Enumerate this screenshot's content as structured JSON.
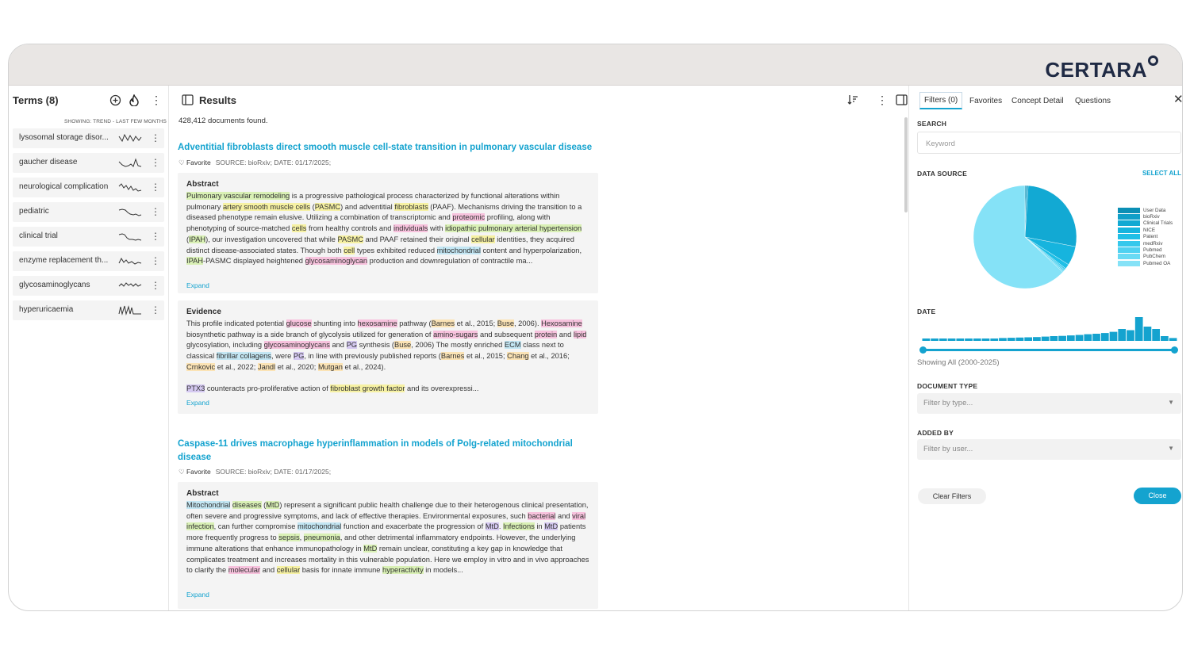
{
  "brand": {
    "name": "CERTARA"
  },
  "terms": {
    "title": "Terms (8)",
    "showing": "SHOWING: TREND - LAST FEW MONTHS",
    "items": [
      {
        "label": "lysosomal storage disor..."
      },
      {
        "label": "gaucher disease"
      },
      {
        "label": "neurological complication"
      },
      {
        "label": "pediatric"
      },
      {
        "label": "clinical trial"
      },
      {
        "label": "enzyme replacement th..."
      },
      {
        "label": "glycosaminoglycans"
      },
      {
        "label": "hyperuricaemia"
      }
    ]
  },
  "results": {
    "title": "Results",
    "count": "428,412 documents found.",
    "favorite_label": "Favorite",
    "expand_label": "Expand",
    "articles": [
      {
        "title": "Adventitial fibroblasts direct smooth muscle cell-state transition in pulmonary vascular disease",
        "meta": "SOURCE: bioRxiv;  DATE: 01/17/2025;",
        "abstract_heading": "Abstract",
        "evidence_heading": "Evidence"
      },
      {
        "title": "Caspase-11 drives macrophage hyperinflammation in models of Polg-related mitochondrial disease",
        "meta": "SOURCE: bioRxiv;  DATE: 01/17/2025;",
        "abstract_heading": "Abstract"
      }
    ]
  },
  "filters": {
    "tabs": [
      "Filters (0)",
      "Favorites",
      "Concept Detail",
      "Questions"
    ],
    "search_label": "SEARCH",
    "search_placeholder": "Keyword",
    "data_source_label": "DATA SOURCE",
    "select_all": "SELECT ALL",
    "legend": [
      "User Data",
      "bioRxiv",
      "Clinical Trials",
      "NICE",
      "Patent",
      "medRxiv",
      "Pubmed",
      "PubChem",
      "Pubmed OA"
    ],
    "legend_colors": [
      "#0b8fb5",
      "#0f9fc8",
      "#12a9d3",
      "#16b4de",
      "#1fbfe6",
      "#35c8ec",
      "#4fd1f1",
      "#69daf4",
      "#85e2f7"
    ],
    "pie_shares": [
      0.004,
      0.006,
      0.27,
      0.06,
      0.015,
      0.005,
      0.005,
      0.004,
      0.631
    ],
    "date_label": "DATE",
    "date_hist": [
      1,
      1,
      1,
      1,
      1,
      1,
      1,
      1,
      1,
      1.2,
      1.3,
      1.4,
      1.5,
      1.6,
      1.8,
      2,
      2.1,
      2.3,
      2.5,
      2.8,
      3,
      3.3,
      3.8,
      5,
      4.5,
      10,
      6,
      5,
      2,
      1.2
    ],
    "date_showing": "Showing All (2000-2025)",
    "doc_type_label": "DOCUMENT TYPE",
    "doc_type_placeholder": "Filter by type...",
    "added_by_label": "ADDED BY",
    "added_by_placeholder": "Filter by user...",
    "clear_label": "Clear Filters",
    "close_label": "Close"
  }
}
